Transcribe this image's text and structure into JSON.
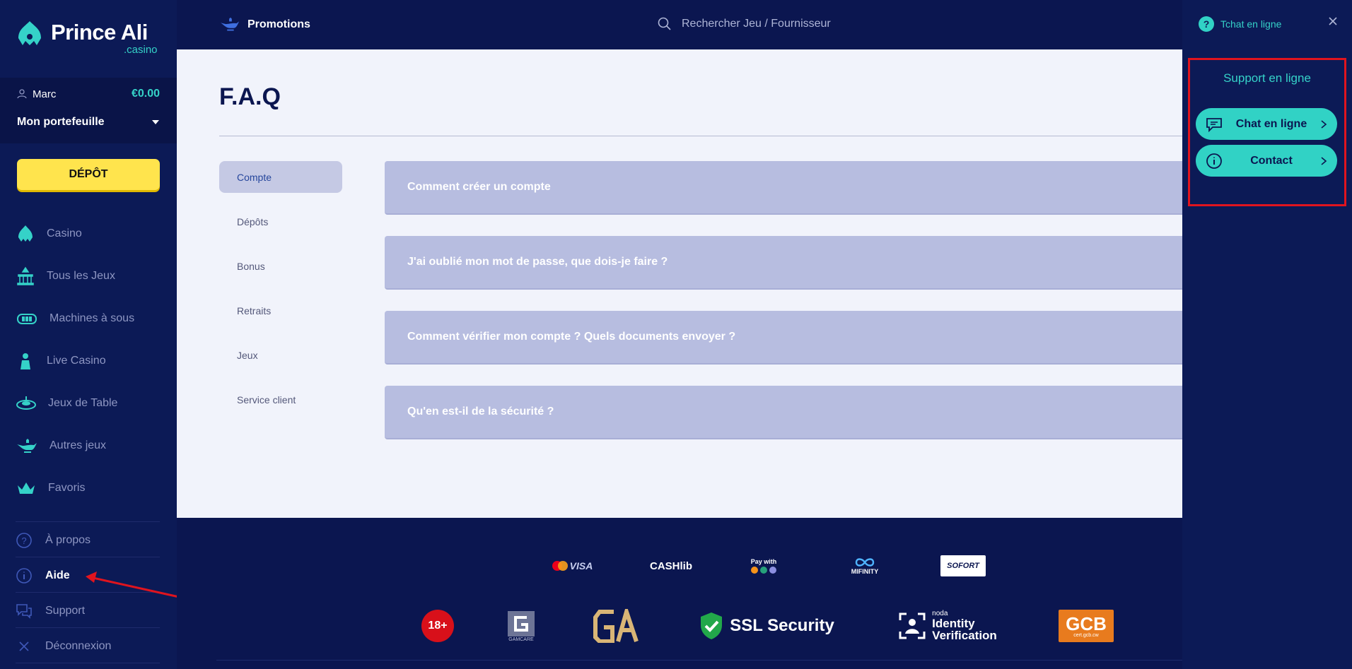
{
  "brand": {
    "name": "Prince Ali",
    "sub": ".casino"
  },
  "user": {
    "name": "Marc",
    "balance": "€0.00",
    "wallet_label": "Mon portefeuille"
  },
  "sidebar": {
    "deposit_label": "DÉPÔT",
    "items": [
      {
        "label": "Casino",
        "icon": "casino-icon"
      },
      {
        "label": "Tous les Jeux",
        "icon": "temple-icon"
      },
      {
        "label": "Machines à sous",
        "icon": "slot-machine-icon"
      },
      {
        "label": "Live Casino",
        "icon": "dealer-icon"
      },
      {
        "label": "Jeux de Table",
        "icon": "roulette-icon"
      },
      {
        "label": "Autres jeux",
        "icon": "lamp-icon"
      },
      {
        "label": "Favoris",
        "icon": "crown-icon"
      }
    ],
    "bottom": [
      {
        "label": "À propos",
        "icon": "question-circle-icon"
      },
      {
        "label": "Aide",
        "icon": "info-circle-icon"
      },
      {
        "label": "Support",
        "icon": "chat-bubbles-icon"
      },
      {
        "label": "Déconnexion",
        "icon": "close-icon"
      }
    ]
  },
  "topbar": {
    "promotions": "Promotions",
    "search_placeholder": "Rechercher Jeu / Fournisseur"
  },
  "main": {
    "title": "F.A.Q",
    "categories": [
      "Compte",
      "Dépôts",
      "Bonus",
      "Retraits",
      "Jeux",
      "Service client"
    ],
    "active_category": "Compte",
    "questions": [
      "Comment créer un compte",
      "J'ai oublié mon mot de passe, que dois-je faire ?",
      "Comment vérifier mon compte ? Quels documents envoyer ?",
      "Qu'en est-il de la sécurité ?"
    ]
  },
  "footer": {
    "payments": [
      "VISA",
      "CASHlib",
      "Pay with",
      "MIFINITY",
      "SOFORT"
    ],
    "badges": {
      "age": "18+",
      "gamcare": "GAMCARE",
      "ssl": "SSL Security",
      "noda_small": "noda",
      "noda_1": "Identity",
      "noda_2": "Verification",
      "gcb": "GCB",
      "gcb_sub": "cert.gcb.cw"
    }
  },
  "support_panel": {
    "header": "Tchat en ligne",
    "title": "Support en ligne",
    "chat_label": "Chat en ligne",
    "contact_label": "Contact"
  },
  "colors": {
    "accent": "#35d2c8",
    "deposit": "#ffe44d",
    "highlight": "#e0141e",
    "sidebar_bg": "#0c1a56"
  }
}
